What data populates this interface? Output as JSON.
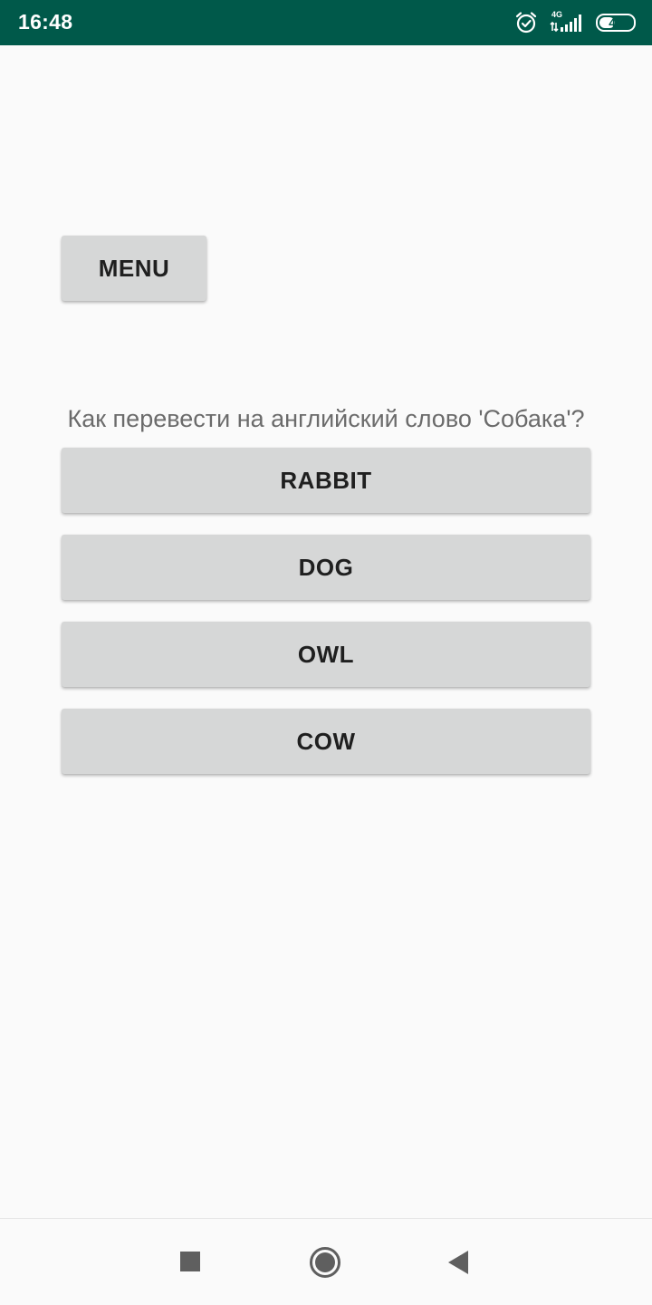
{
  "status_bar": {
    "time": "16:48",
    "network_type": "4G",
    "battery_level": "46",
    "battery_fraction": 0.46,
    "icons": [
      "alarm-icon",
      "signal-icon",
      "battery-icon"
    ]
  },
  "menu_label": "MENU",
  "question": "Как перевести на английский слово 'Собака'?",
  "answers": [
    "RABBIT",
    "DOG",
    "OWL",
    "COW"
  ],
  "nav_bar": {
    "icons": [
      "recents-icon",
      "home-icon",
      "back-icon"
    ]
  },
  "colors": {
    "status_bar": "#00594a",
    "background": "#fafafa",
    "button": "#d6d7d7",
    "button_text": "#1f1f1f",
    "question_text": "#6b6b6b",
    "nav_icons": "#5f5f5f"
  }
}
